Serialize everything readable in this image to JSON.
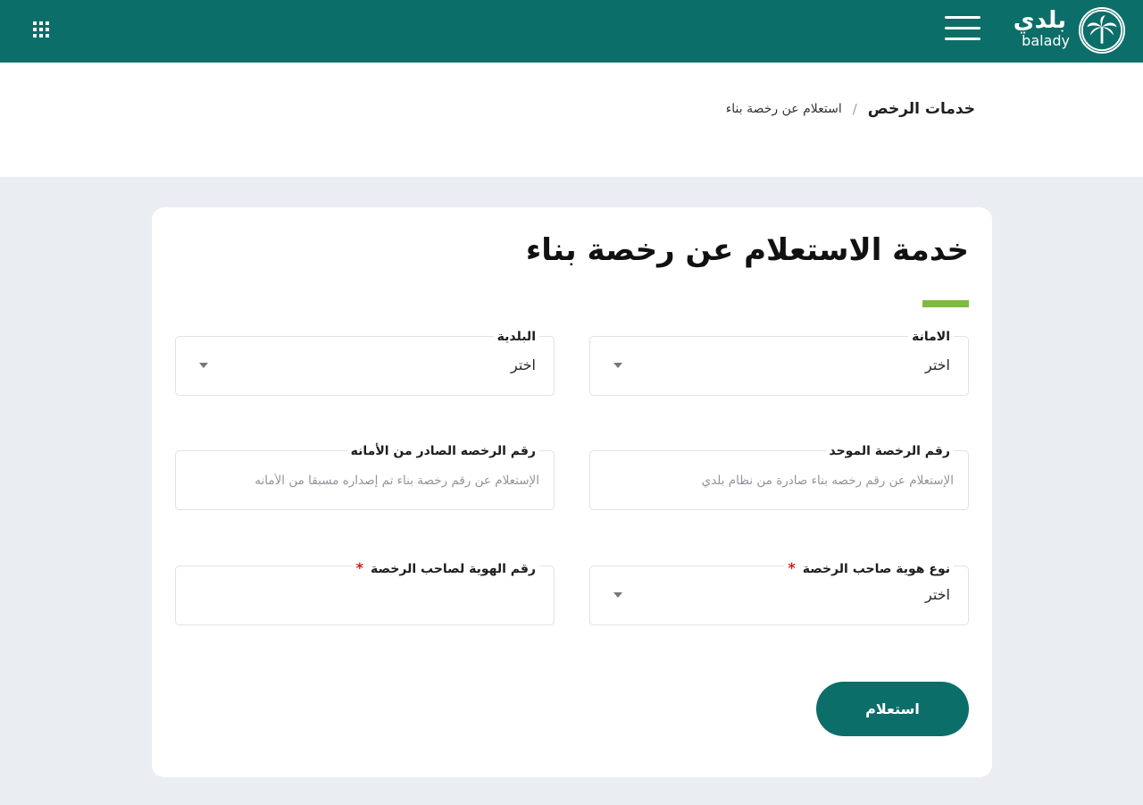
{
  "header": {
    "logo_ar": "بلدي",
    "logo_en": "balady",
    "menu_icon": "hamburger-icon",
    "apps_icon": "grid-icon",
    "background_color": "#0c6e69"
  },
  "breadcrumb": {
    "home": "خدمات الرخص",
    "separator": "/",
    "current": "استعلام عن رخصة بناء"
  },
  "form": {
    "title": "خدمة الاستعلام عن رخصة بناء",
    "accent_color": "#7fba43",
    "fields": {
      "amana": {
        "label": "الامانة",
        "value": "اختر"
      },
      "baladia": {
        "label": "البلدية",
        "value": "اختر"
      },
      "unified_license": {
        "label": "رقم الرخصة الموحد",
        "placeholder": "الإستعلام عن رقم رخصه بناء صادرة من نظام بلدي"
      },
      "amana_license": {
        "label": "رقم الرخصه الصادر من الأمانه",
        "placeholder": "الإستعلام عن رقم رخصة بناء تم إصداره مسبقا من الأمانه"
      },
      "owner_id_type": {
        "label": "نوع هوية صاحب الرخصة",
        "value": "اختر",
        "required_mark": "*"
      },
      "owner_id_number": {
        "label": "رقم الهوية لصاحب الرخصة",
        "value": "",
        "required_mark": "*"
      }
    },
    "submit_label": "استعلام",
    "button_color": "#0c6e69"
  }
}
